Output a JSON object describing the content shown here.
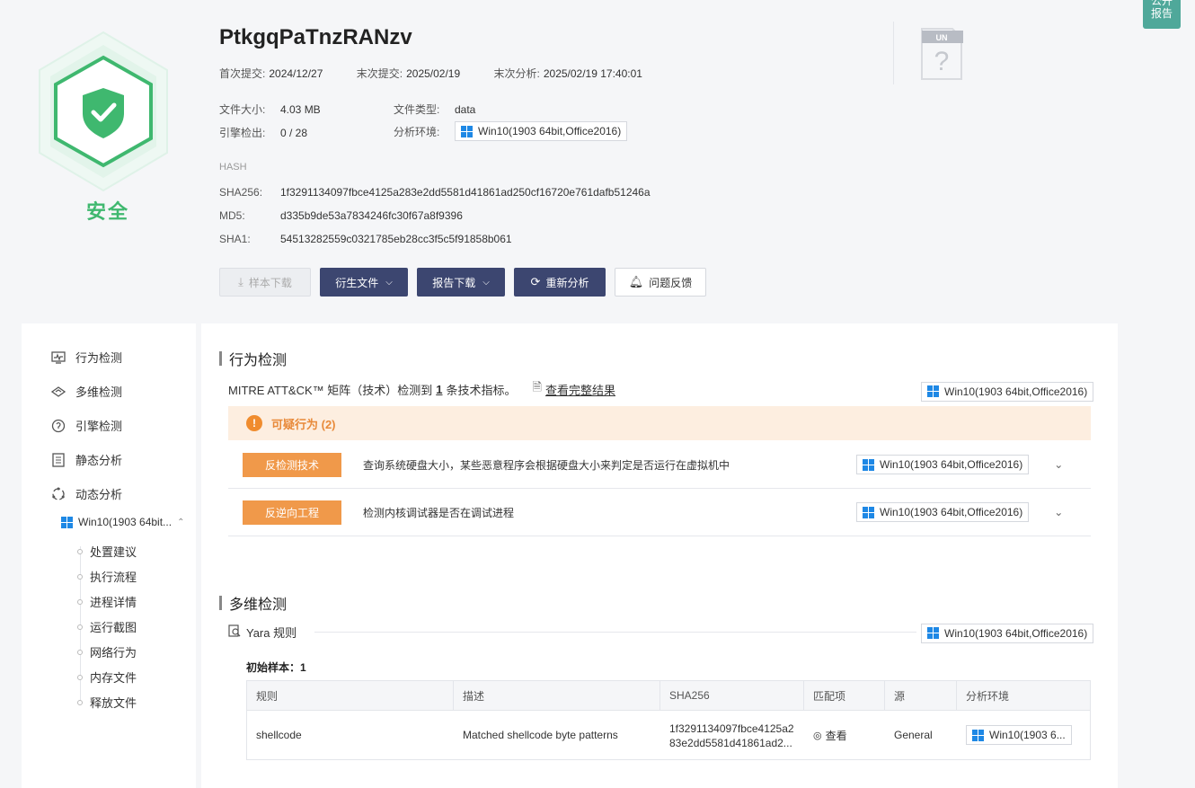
{
  "badge": "公开\n报告",
  "verdict": "安全",
  "file": {
    "name": "PtkgqPaTnzRANzv",
    "first_submit_label": "首次提交:",
    "first_submit": "2024/12/27",
    "last_submit_label": "末次提交:",
    "last_submit": "2025/02/19",
    "last_analysis_label": "末次分析:",
    "last_analysis": "2025/02/19 17:40:01",
    "size_label": "文件大小:",
    "size": "4.03 MB",
    "type_label": "文件类型:",
    "type": "data",
    "engine_label": "引擎检出:",
    "engine": "0 / 28",
    "env_label": "分析环境:",
    "env": "Win10(1903 64bit,Office2016)"
  },
  "hash": {
    "title": "HASH",
    "sha256_label": "SHA256:",
    "sha256": "1f3291134097fbce4125a283e2dd5581d41861ad250cf16720e761dafb51246a",
    "md5_label": "MD5:",
    "md5": "d335b9de53a7834246fc30f67a8f9396",
    "sha1_label": "SHA1:",
    "sha1": "54513282559c0321785eb28cc3f5c5f91858b061"
  },
  "unknown_icon_label": "UN",
  "buttons": {
    "download_sample": "样本下载",
    "derived_files": "衍生文件",
    "report_download": "报告下载",
    "reanalyze": "重新分析",
    "feedback": "问题反馈"
  },
  "sidebar": {
    "items": [
      {
        "label": "行为检测",
        "icon": "monitor-icon"
      },
      {
        "label": "多维检测",
        "icon": "layers-icon"
      },
      {
        "label": "引擎检测",
        "icon": "engine-icon"
      },
      {
        "label": "静态分析",
        "icon": "list-icon"
      },
      {
        "label": "动态分析",
        "icon": "cycle-icon"
      }
    ],
    "env": "Win10(1903 64bit...",
    "sub_items": [
      "处置建议",
      "执行流程",
      "进程详情",
      "运行截图",
      "网络行为",
      "内存文件",
      "释放文件"
    ]
  },
  "behavior": {
    "title": "行为检测",
    "mitre_prefix": "MITRE ATT&CK™ 矩阵（技术）检测到",
    "mitre_count": "1",
    "mitre_suffix": "条技术指标。",
    "view_full": "查看完整结果",
    "env": "Win10(1903 64bit,Office2016)",
    "suspicious": "可疑行为 (2)",
    "rows": [
      {
        "tag": "反检测技术",
        "desc": "查询系统硬盘大小，某些恶意程序会根据硬盘大小来判定是否运行在虚拟机中",
        "env": "Win10(1903 64bit,Office2016)"
      },
      {
        "tag": "反逆向工程",
        "desc": "检测内核调试器是否在调试进程",
        "env": "Win10(1903 64bit,Office2016)"
      }
    ]
  },
  "multi": {
    "title": "多维检测",
    "yara_label": "Yara 规则",
    "env": "Win10(1903 64bit,Office2016)",
    "initial_sample": "初始样本：1",
    "columns": [
      "规则",
      "描述",
      "SHA256",
      "匹配项",
      "源",
      "分析环境"
    ],
    "row": {
      "rule": "shellcode",
      "desc": "Matched shellcode byte patterns",
      "sha_line1": "1f3291134097fbce4125a2",
      "sha_line2": "83e2dd5581d41861ad2...",
      "match": "查看",
      "source": "General",
      "env": "Win10(1903 6..."
    }
  },
  "colors": {
    "safe": "#3fb86f",
    "dark_button": "#3c4670",
    "orange_tag": "#f0994a",
    "banner": "#fdeee0"
  }
}
